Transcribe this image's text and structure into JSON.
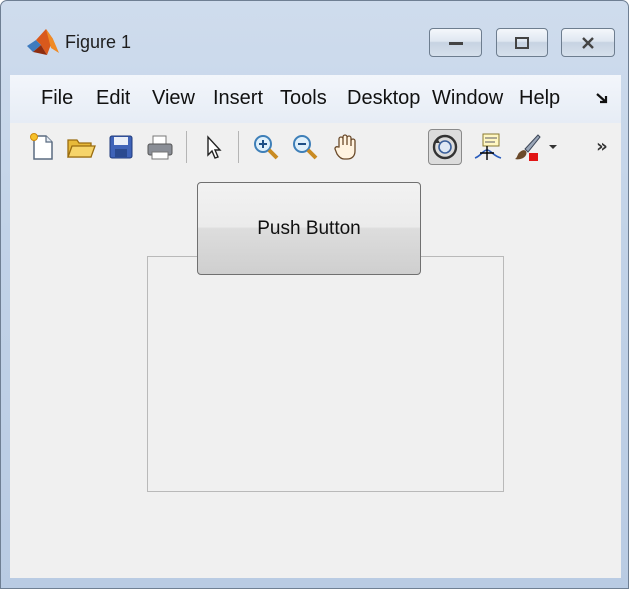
{
  "window": {
    "title": "Figure 1",
    "icon": "matlab-logo-icon",
    "caption_buttons": [
      "minimize-icon",
      "maximize-icon",
      "close-icon"
    ]
  },
  "menubar": {
    "items": [
      "File",
      "Edit",
      "View",
      "Insert",
      "Tools",
      "Desktop",
      "Window",
      "Help"
    ],
    "overflow_icon": "menu-overflow-icon"
  },
  "toolbar": {
    "tools": [
      "new-figure-icon",
      "open-file-icon",
      "save-icon",
      "print-icon",
      "pointer-icon",
      "zoom-in-icon",
      "zoom-out-icon",
      "pan-icon",
      "rotate-3d-icon",
      "data-cursor-icon",
      "brush-icon",
      "chevron-down-icon",
      "more-tools-icon"
    ],
    "pressed_tool": "rotate-3d-icon"
  },
  "figure": {
    "push_button_label": "Push Button"
  }
}
